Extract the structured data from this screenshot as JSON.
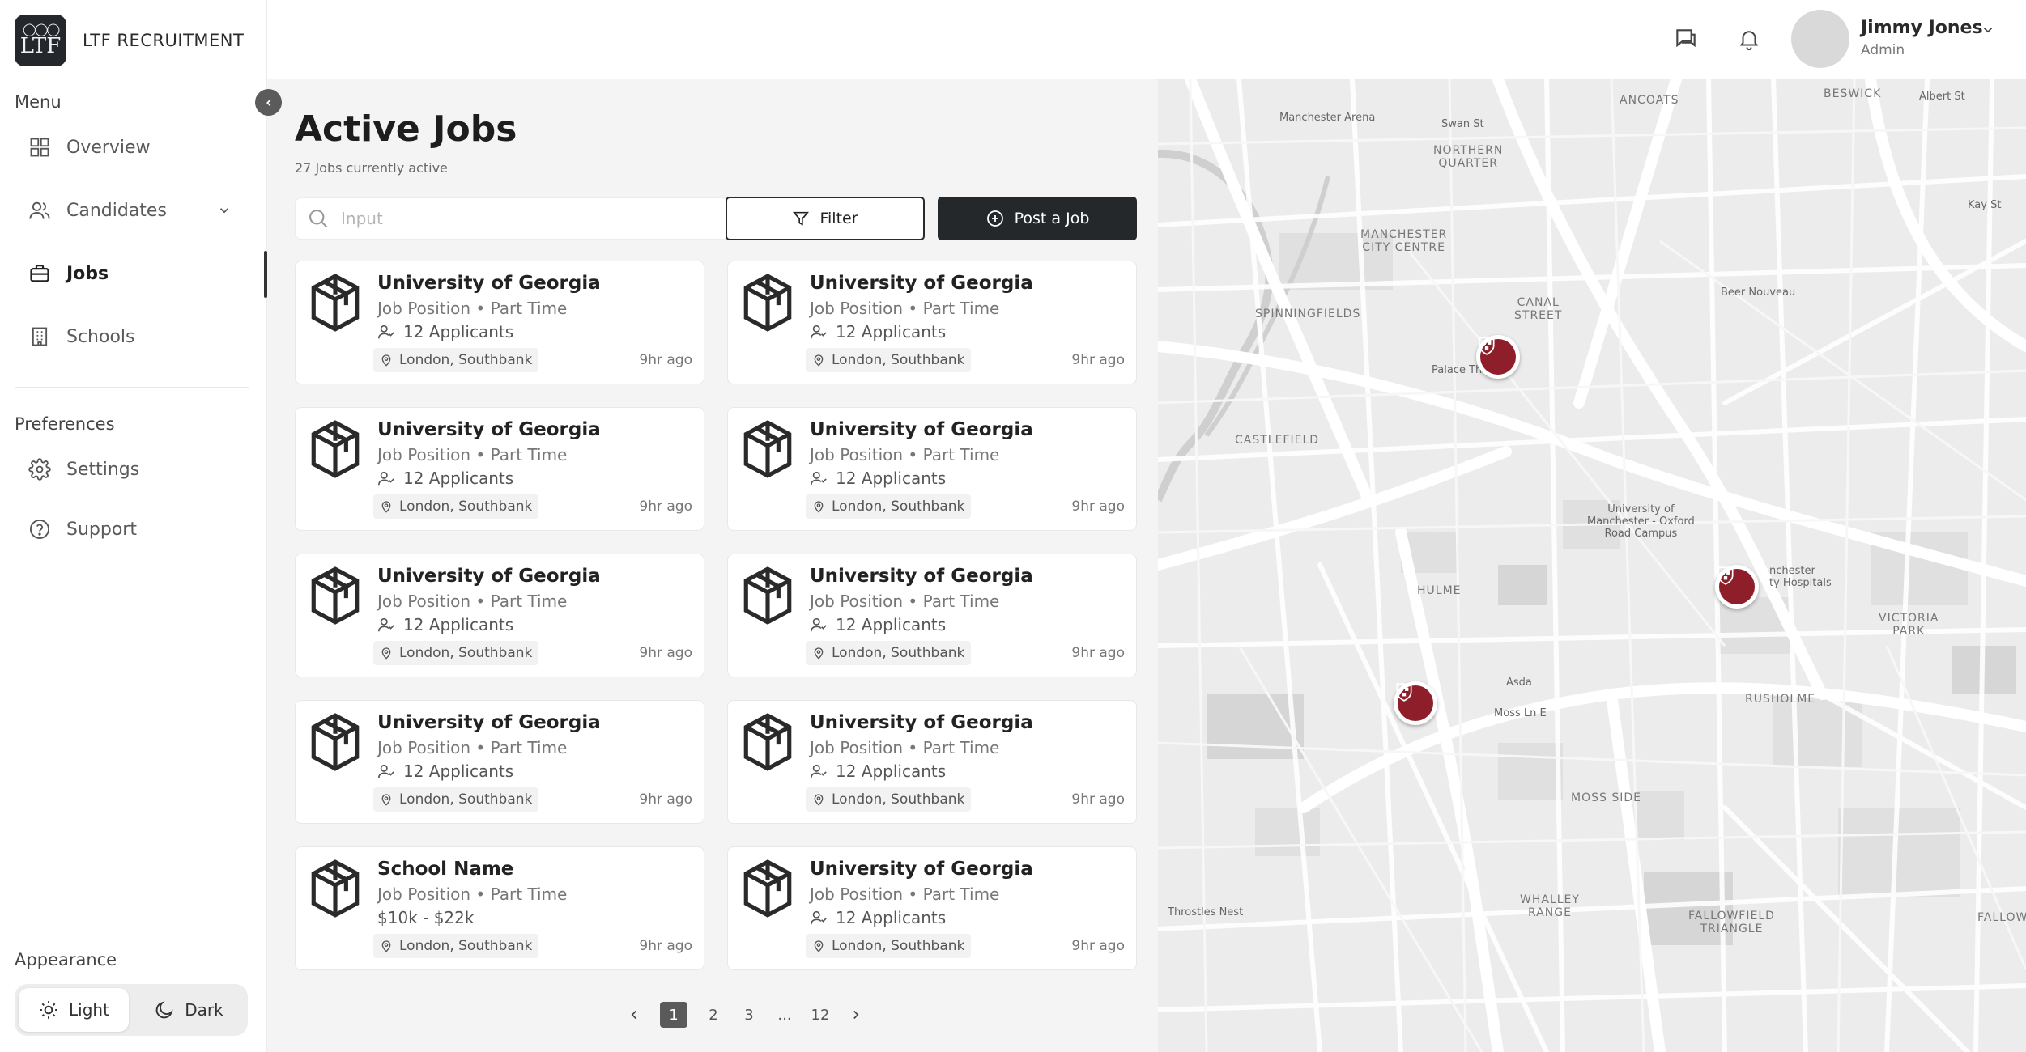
{
  "brand": {
    "logo_text": "LTF",
    "name": "LTF RECRUITMENT"
  },
  "sidebar": {
    "menu_title": "Menu",
    "items": [
      {
        "label": "Overview",
        "icon": "grid-icon"
      },
      {
        "label": "Candidates",
        "icon": "users-icon"
      },
      {
        "label": "Jobs",
        "icon": "briefcase-icon",
        "active": true
      },
      {
        "label": "Schools",
        "icon": "building-icon"
      }
    ],
    "preferences_title": "Preferences",
    "pref_items": [
      {
        "label": "Settings",
        "icon": "gear-icon"
      },
      {
        "label": "Support",
        "icon": "help-circle-icon"
      }
    ],
    "appearance_title": "Appearance",
    "appearance": {
      "light": "Light",
      "dark": "Dark",
      "selected": "Light"
    }
  },
  "user": {
    "name": "Jimmy Jones",
    "role": "Admin"
  },
  "main": {
    "title": "Active Jobs",
    "subtitle": "27 Jobs currently active",
    "search_placeholder": "Input",
    "filter_label": "Filter",
    "post_label": "Post a Job"
  },
  "jobs": [
    {
      "title": "University of Georgia",
      "position": "Job Position • Part Time",
      "applicants": "12 Applicants",
      "location": "London, Southbank",
      "time": "9hr ago"
    },
    {
      "title": "University of Georgia",
      "position": "Job Position • Part Time",
      "applicants": "12 Applicants",
      "location": "London, Southbank",
      "time": "9hr ago"
    },
    {
      "title": "University of Georgia",
      "position": "Job Position • Part Time",
      "applicants": "12 Applicants",
      "location": "London, Southbank",
      "time": "9hr ago"
    },
    {
      "title": "University of Georgia",
      "position": "Job Position • Part Time",
      "applicants": "12 Applicants",
      "location": "London, Southbank",
      "time": "9hr ago"
    },
    {
      "title": "University of Georgia",
      "position": "Job Position • Part Time",
      "applicants": "12 Applicants",
      "location": "London, Southbank",
      "time": "9hr ago"
    },
    {
      "title": "University of Georgia",
      "position": "Job Position • Part Time",
      "applicants": "12 Applicants",
      "location": "London, Southbank",
      "time": "9hr ago"
    },
    {
      "title": "University of Georgia",
      "position": "Job Position • Part Time",
      "applicants": "12 Applicants",
      "location": "London, Southbank",
      "time": "9hr ago"
    },
    {
      "title": "University of Georgia",
      "position": "Job Position • Part Time",
      "applicants": "12 Applicants",
      "location": "London, Southbank",
      "time": "9hr ago"
    },
    {
      "title": "School Name",
      "position": "Job Position • Part Time",
      "salary": "$10k - $22k",
      "location": "London, Southbank",
      "time": "9hr ago"
    },
    {
      "title": "University of Georgia",
      "position": "Job Position • Part Time",
      "applicants": "12 Applicants",
      "location": "London, Southbank",
      "time": "9hr ago"
    }
  ],
  "pagination": {
    "pages": [
      "1",
      "2",
      "3",
      "...",
      "12"
    ],
    "current": "1"
  },
  "map": {
    "labels": {
      "beswick": "BESWICK",
      "ancoats": "ANCOATS",
      "manchester_arena": "Manchester Arena",
      "northern_quarter": "NORTHERN\nQUARTER",
      "city_centre": "MANCHESTER\nCITY CENTRE",
      "spinningfields": "SPINNINGFIELDS",
      "canal_street": "CANAL\nSTREET",
      "beer_nouveau": "Beer Nouveau",
      "palace_theatre": "Palace Th",
      "castlefield": "CASTLEFIELD",
      "university": "University of\nManchester - Oxford\nRoad Campus",
      "hulme": "HULME",
      "hospitals": "nchester\nty Hospitals",
      "victoria_park": "VICTORIA\nPARK",
      "asda": "Asda",
      "moss_ln_e": "Moss Ln E",
      "rusholme": "RUSHOLME",
      "moss_side": "MOSS SIDE",
      "whalley_range": "WHALLEY\nRANGE",
      "fallowfield_triangle": "FALLOWFIELD\nTRIANGLE",
      "throstles_nest": "Throstles Nest",
      "fallow": "FALLOW",
      "swan_st": "Swan St",
      "albert_st": "Albert St",
      "kay_st": "Kay St"
    },
    "pin_color": "#8e1f2a"
  },
  "colors": {
    "accent_dark": "#25282b",
    "background": "#f4f4f4"
  }
}
